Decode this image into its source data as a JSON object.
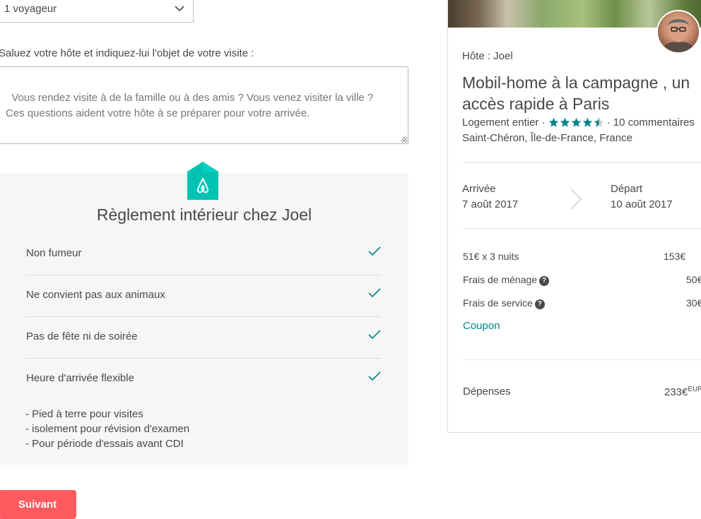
{
  "form": {
    "guests_value": "1 voyageur",
    "message_label": "Saluez votre hôte et indiquez-lui l'objet de votre visite :",
    "message_placeholder": "Vous rendez visite à de la famille ou à des amis ? Vous venez visiter la ville ?\nCes questions aident votre hôte à se préparer pour votre arrivée.",
    "next_button": "Suivant"
  },
  "rules": {
    "title": "Règlement intérieur chez Joel",
    "items": [
      {
        "label": "Non fumeur",
        "allowed_icon": "check-icon"
      },
      {
        "label": "Ne convient pas aux animaux",
        "allowed_icon": "check-icon"
      },
      {
        "label": "Pas de fête ni de soirée",
        "allowed_icon": "check-icon"
      },
      {
        "label": "Heure d'arrivée flexible",
        "allowed_icon": "check-icon"
      }
    ],
    "notes": [
      "- Pied à terre pour visites",
      "- isolement pour révision d'examen",
      "- Pour période d'essais avant CDI"
    ]
  },
  "listing": {
    "host_line": "Hôte : Joel",
    "title": "Mobil-home à la campagne , un accès rapide à Paris",
    "type": "Logement entier ·",
    "rating_stars": 4.5,
    "reviews": "· 10 commentaires",
    "location": "Saint-Chéron, Île-de-France, France"
  },
  "dates": {
    "checkin_label": "Arrivée",
    "checkin_value": "7 août 2017",
    "checkout_label": "Départ",
    "checkout_value": "10 août 2017"
  },
  "pricing": {
    "nights_label": "51€ x 3 nuits",
    "nights_amount": "153€",
    "cleaning_label": "Frais de ménage",
    "cleaning_amount": "50€",
    "service_label": "Frais de service",
    "service_amount": "30€",
    "coupon_label": "Coupon",
    "total_label": "Dépenses",
    "total_amount": "233€",
    "total_currency": "EUR"
  },
  "colors": {
    "accent_teal": "#008489",
    "brand_red": "#ff5a5f",
    "logo_teal": "#00d1c1"
  }
}
